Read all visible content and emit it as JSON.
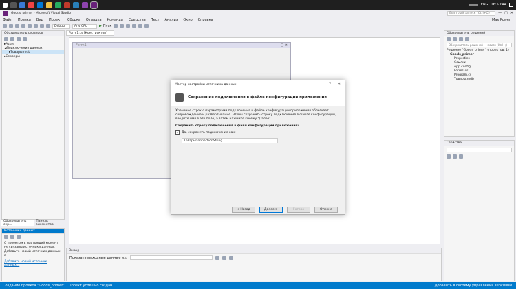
{
  "taskbar": {
    "search_placeholder": "Быстрый запуск (Ctrl+Q)",
    "lang": "ENG",
    "time": "16:50:44",
    "date": "10.06.2018",
    "user": "Max Power"
  },
  "window": {
    "title": "Goods_primer - Microsoft Visual Studio"
  },
  "menu": [
    "Файл",
    "Правка",
    "Вид",
    "Проект",
    "Сборка",
    "Отладка",
    "Команда",
    "Средства",
    "Тест",
    "Анализ",
    "Окно",
    "Справка"
  ],
  "toolbar": {
    "config": "Debug",
    "platform": "Any CPU",
    "start_label": "Пуск"
  },
  "server_explorer": {
    "title": "Обозреватель серверов",
    "items": [
      {
        "label": "Azure",
        "indent": 0
      },
      {
        "label": "Подключения данных",
        "indent": 0
      },
      {
        "label": "Товары.mdb",
        "indent": 1
      },
      {
        "label": "Серверы",
        "indent": 0
      }
    ],
    "tabs": [
      "Обозреватель сер...",
      "Панель элементов"
    ]
  },
  "data_sources": {
    "title": "Источники данных",
    "text": "С проектом в настоящий момент не связаны источники данных. Добавьте новый источник данных, а",
    "link": "Добавить новый источник данных..."
  },
  "editor": {
    "tab": "Form1.cs [Конструктор]",
    "form_title": "Form1"
  },
  "output": {
    "title": "Вывод",
    "label": "Показать выходные данные из:"
  },
  "solution_explorer": {
    "title": "Обозреватель решений",
    "search_placeholder": "Обозреватель решений — поиск (Ctrl+;)",
    "items": [
      {
        "label": "Решение \"Goods_primer\" (проектов: 1)",
        "indent": 0
      },
      {
        "label": "Goods_primer",
        "indent": 1
      },
      {
        "label": "Properties",
        "indent": 2
      },
      {
        "label": "Ссылки",
        "indent": 2
      },
      {
        "label": "App.config",
        "indent": 2
      },
      {
        "label": "Form1.cs",
        "indent": 2
      },
      {
        "label": "Program.cs",
        "indent": 2
      },
      {
        "label": "Товары.mdb",
        "indent": 2
      }
    ]
  },
  "properties": {
    "title": "Свойства"
  },
  "dialog": {
    "title": "Мастер настройки источника данных",
    "help": "?",
    "heading": "Сохранение подключения в файле конфигурации приложения",
    "description": "Хранение строк с параметрами подключения в файле конфигурации приложения облегчает сопровождение и развертывание. Чтобы сохранить строку подключения в файле конфигурации, введите имя в это поле, а затем нажмите кнопку \"Далее\".",
    "question": "Сохранить строку подключения в файл конфигурации приложения?",
    "checkbox_label": "Да, сохранить подключение как:",
    "checkbox_checked": true,
    "conn_name": "ТоварыConnectionString",
    "buttons": {
      "back": "< Назад",
      "next": "Далее >",
      "finish": "Готово",
      "cancel": "Отмена"
    }
  },
  "status": {
    "left": "Создание проекта \"Goods_primer\"... Проект успешно создан",
    "right": "Добавить в систему управления версиями"
  },
  "colors": {
    "accent": "#007acc",
    "taskbar": "#1f1f1f",
    "vs_purple": "#68217a"
  }
}
